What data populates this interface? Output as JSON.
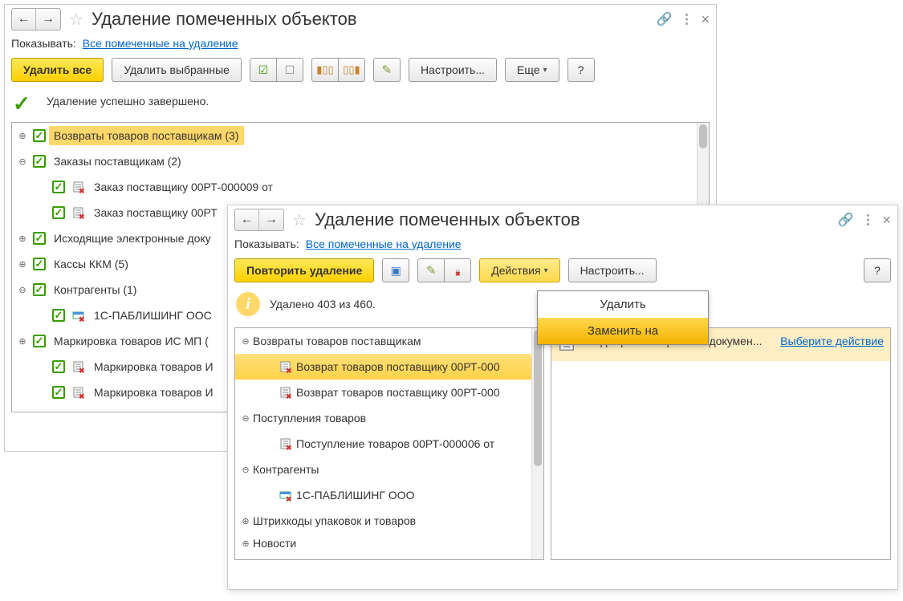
{
  "back": {
    "title": "Удаление помеченных объектов",
    "filter_label": "Показывать:",
    "filter_link": "Все помеченные на удаление",
    "tb": {
      "delete_all": "Удалить все",
      "delete_sel": "Удалить выбранные",
      "setup": "Настроить...",
      "more": "Еще",
      "help": "?"
    },
    "status": "Удаление успешно завершено.",
    "tree": [
      {
        "exp": "+",
        "label": "Возвраты товаров поставщикам (3)",
        "hilite": true
      },
      {
        "exp": "-",
        "label": "Заказы поставщикам (2)"
      },
      {
        "exp": "",
        "label": "Заказ поставщику 00РТ-000009 от",
        "child": true,
        "doc": true
      },
      {
        "exp": "",
        "label": "Заказ поставщику 00РТ",
        "child": true,
        "doc": true
      },
      {
        "exp": "+",
        "label": "Исходящие электронные доку"
      },
      {
        "exp": "+",
        "label": "Кассы ККМ (5)"
      },
      {
        "exp": "-",
        "label": "Контрагенты (1)"
      },
      {
        "exp": "",
        "label": "1С-ПАБЛИШИНГ ООС",
        "child": true,
        "card": true
      },
      {
        "exp": "+",
        "label": "Маркировка товаров ИС МП ("
      },
      {
        "exp": "",
        "label": "Маркировка товаров И",
        "child": true,
        "doc": true
      },
      {
        "exp": "",
        "label": "Маркировка товаров И",
        "child": true,
        "doc": true
      }
    ]
  },
  "front": {
    "title": "Удаление помеченных объектов",
    "filter_label": "Показывать:",
    "filter_link": "Все помеченные на удаление",
    "tb": {
      "retry": "Повторить удаление",
      "actions": "Действия",
      "setup": "Настроить...",
      "help": "?"
    },
    "status": "Удалено 403 из 460.",
    "dd": {
      "delete": "Удалить",
      "replace": "Заменить на"
    },
    "tree": [
      {
        "exp": "-",
        "label": "Возвраты товаров поставщикам"
      },
      {
        "exp": "",
        "label": "Возврат товаров поставщику 00РТ-000",
        "child": true,
        "doc": true,
        "sel": true
      },
      {
        "exp": "",
        "label": "Возврат товаров поставщику 00РТ-000",
        "child": true,
        "doc": true
      },
      {
        "exp": "-",
        "label": "Поступления товаров"
      },
      {
        "exp": "",
        "label": "Поступление товаров 00РТ-000006 от",
        "child": true,
        "doc": true
      },
      {
        "exp": "-",
        "label": "Контрагенты"
      },
      {
        "exp": "",
        "label": "1С-ПАБЛИШИНГ ООО",
        "child": true,
        "card": true
      },
      {
        "exp": "+",
        "label": "Штрихкоды упаковок и товаров"
      },
      {
        "exp": "+",
        "label": "Новости",
        "trunc": true
      }
    ],
    "right": {
      "doc_label": "Исходящий электронный докумен...",
      "link": "Выберите действие"
    }
  }
}
